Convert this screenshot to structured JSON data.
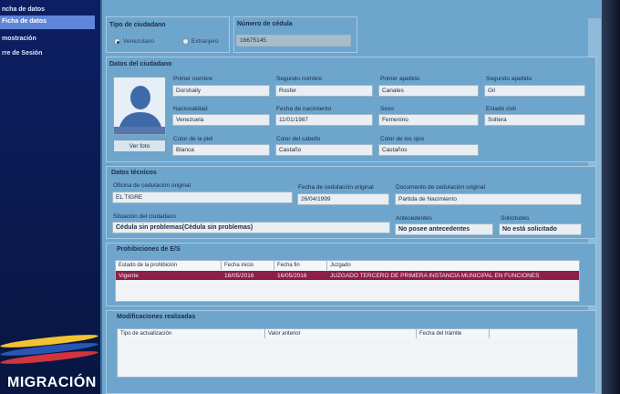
{
  "sidebar": {
    "items": [
      {
        "label": "ncha de datos"
      },
      {
        "label": "Ficha de datos"
      },
      {
        "label": "mostración"
      },
      {
        "label": "rre de Sesión"
      }
    ],
    "brand": "MIGRACIÓN",
    "flag_colors": [
      "#f2c230",
      "#2a55b5",
      "#d0343c"
    ]
  },
  "tipo": {
    "title": "Tipo de ciudadano",
    "options": [
      "Venezolano",
      "Extranjero"
    ],
    "selected": "Venezolano"
  },
  "cedula": {
    "title": "Número de cédula",
    "value": "16675145"
  },
  "datos": {
    "title": "Datos del ciudadano",
    "primer_nombre": {
      "label": "Primer nombre",
      "value": "Dorshaily"
    },
    "segundo_nombre": {
      "label": "Segundo nombre",
      "value": "Rosfer"
    },
    "primer_apellido": {
      "label": "Primer apellido",
      "value": "Canales"
    },
    "segundo_apellido": {
      "label": "Segundo apellido",
      "value": "Gil"
    },
    "nacionalidad": {
      "label": "Nacionalidad",
      "value": "Venezuela"
    },
    "fecha_nacimiento": {
      "label": "Fecha de nacimiento",
      "value": "11/01/1987"
    },
    "sexo": {
      "label": "Sexo",
      "value": "Femenino"
    },
    "estado_civil": {
      "label": "Estado civil",
      "value": "Soltera"
    },
    "color_piel": {
      "label": "Color de la piel",
      "value": "Blanca"
    },
    "color_cabello": {
      "label": "Color del cabello",
      "value": "Castaño"
    },
    "color_ojos": {
      "label": "Color de los ojos",
      "value": "Castaños"
    },
    "photo_button": "Ver foto"
  },
  "tecnicos": {
    "title": "Datos técnicos",
    "oficina": {
      "label": "Oficina de cedulación original",
      "value": "EL TIGRE"
    },
    "fecha_cedulacion": {
      "label": "Fecha de cedulación original",
      "value": "26/04/1999"
    },
    "documento": {
      "label": "Documento de cedulación original",
      "value": "Partida de Nacimiento"
    },
    "situacion": {
      "label": "Situación del ciudadano",
      "value": "Cédula sin problemas(Cédula sin problemas)"
    },
    "antecedentes": {
      "label": "Antecedentes",
      "value": "No posee  antecedentes"
    },
    "solicitudes": {
      "label": "Solicitudes",
      "value": "No está solicitado"
    }
  },
  "prohibiciones": {
    "title": "Prohibiciones de E/S",
    "columns": [
      "Estado de la prohibición",
      "Fecha inicio",
      "Fecha fin",
      "Juzgado"
    ],
    "rows": [
      [
        "Vigente",
        "16/05/2016",
        "16/05/2016",
        "JUZGADO TERCERO DE PRIMERA INSTANCIA MUNICIPAL EN FUNCIONES"
      ]
    ]
  },
  "modificaciones": {
    "title": "Modificaciones realizadas",
    "columns": [
      "Tipo de actualización",
      "Valor anterior",
      "Fecha del trámite",
      ""
    ]
  }
}
